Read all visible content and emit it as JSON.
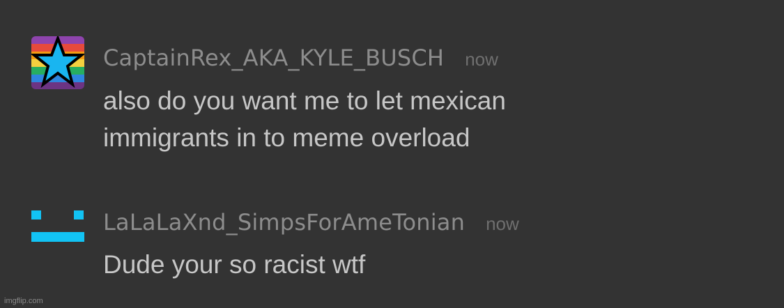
{
  "messages": [
    {
      "author": "CaptainRex_AKA_KYLE_BUSCH",
      "time": "now",
      "text_lines": [
        "also do you want me to let mexican",
        "immigrants in to meme overload"
      ],
      "avatar_icon": "rainbow-star-avatar-icon"
    },
    {
      "author": "LaLaLaXnd_SimpsForAmeTonian",
      "time": "now",
      "text_lines": [
        "Dude your so racist wtf"
      ],
      "avatar_icon": "cyan-face-avatar-icon"
    }
  ],
  "watermark": "imgflip.com",
  "colors": {
    "background": "#333333",
    "username": "#8d8d8d",
    "timestamp": "#6f6f6f",
    "message_text": "#c7c7c7",
    "star_fill": "#19b5f0",
    "face_color": "#12c3f4"
  }
}
